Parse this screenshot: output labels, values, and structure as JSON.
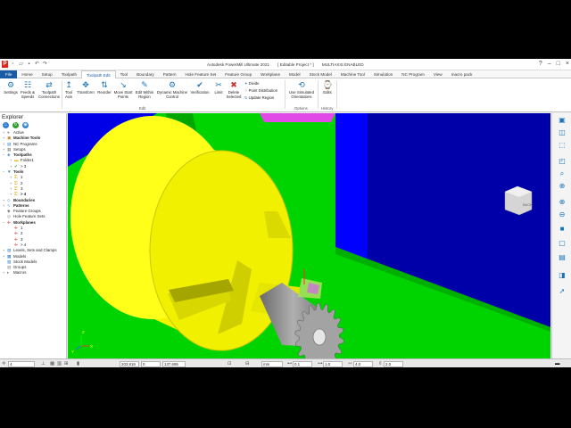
{
  "window": {
    "title": "Autodesk PowerMill Ultimate 2021",
    "project": "[ Editable Project * ]",
    "multiaxis": "MULTIAXIS ENABLED",
    "logo": "P"
  },
  "tabs": [
    "File",
    "Home",
    "Setup",
    "Toolpath",
    "Toolpath Edit",
    "Tool",
    "Boundary",
    "Pattern",
    "Hole Feature Set",
    "Feature Group",
    "Workplane",
    "Model",
    "Stock Model",
    "Machine Tool",
    "Simulation",
    "NC Program",
    "View",
    "macro pack"
  ],
  "ribbon": {
    "buttons": [
      {
        "id": "settings",
        "label": "Settings",
        "icon": "⚙"
      },
      {
        "id": "feeds",
        "label": "Feeds & Speeds",
        "icon": "☷"
      },
      {
        "id": "connections",
        "label": "Toolpath Connections",
        "icon": "⇄"
      },
      {
        "id": "tool-axis",
        "label": "Tool Axis",
        "icon": "↥"
      },
      {
        "id": "transform",
        "label": "Transform",
        "icon": "✥"
      },
      {
        "id": "reorder",
        "label": "Reorder",
        "icon": "⇅"
      },
      {
        "id": "move-start",
        "label": "Move Start Points",
        "icon": "↘"
      },
      {
        "id": "edit-region",
        "label": "Edit Within Region",
        "icon": "✎"
      },
      {
        "id": "dynamic",
        "label": "Dynamic Machine Control",
        "icon": "⚙"
      },
      {
        "id": "verification",
        "label": "Verification",
        "icon": "✔"
      },
      {
        "id": "limit",
        "label": "Limit",
        "icon": "✂"
      },
      {
        "id": "delete-selected",
        "label": "Delete Selected",
        "icon": "✖"
      },
      {
        "id": "simulated",
        "label": "Use Simulated Orientations",
        "icon": "⟲"
      },
      {
        "id": "edits",
        "label": "Edits",
        "icon": "⌚"
      }
    ],
    "small_buttons": [
      {
        "id": "divide",
        "label": "Divide",
        "icon": "✦"
      },
      {
        "id": "point-distribution",
        "label": "Point Distribution",
        "icon": "⁘"
      },
      {
        "id": "update-region",
        "label": "Update Region",
        "icon": "↻"
      }
    ],
    "groups": {
      "edit": "Edit",
      "options": "Options",
      "history": "History"
    }
  },
  "explorer": {
    "title": "Explorer",
    "tree": [
      {
        "label": "Active",
        "level": 0,
        "bold": false,
        "expand": "+",
        "icon": "●",
        "color": "#888888"
      },
      {
        "label": "Machine Tools",
        "level": 0,
        "bold": true,
        "expand": "+",
        "icon": "▣",
        "color": "#d07a20"
      },
      {
        "label": "NC Programs",
        "level": 0,
        "bold": false,
        "expand": "+",
        "icon": "▤",
        "color": "#2f7fd0"
      },
      {
        "label": "Setups",
        "level": 0,
        "bold": false,
        "expand": "+",
        "icon": "▦",
        "color": "#888888"
      },
      {
        "label": "Toolpaths",
        "level": 0,
        "bold": true,
        "expand": "−",
        "icon": "◈",
        "color": "#2f7fd0"
      },
      {
        "label": "Folder1",
        "level": 1,
        "bold": false,
        "expand": "+",
        "icon": "▬",
        "color": "#e6b800"
      },
      {
        "label": "> 3",
        "level": 1,
        "bold": false,
        "expand": "+",
        "icon": "✔",
        "color": "#2e9e2e"
      },
      {
        "label": "Tools",
        "level": 0,
        "bold": true,
        "expand": "−",
        "icon": "▼",
        "color": "#2f7fd0"
      },
      {
        "label": "1",
        "level": 1,
        "bold": false,
        "expand": "+",
        "icon": "⚿",
        "color": "#d4a000"
      },
      {
        "label": "2",
        "level": 1,
        "bold": false,
        "expand": "+",
        "icon": "⚿",
        "color": "#d4a000"
      },
      {
        "label": "3",
        "level": 1,
        "bold": false,
        "expand": "+",
        "icon": "⚿",
        "color": "#d4a000"
      },
      {
        "label": "> 4",
        "level": 1,
        "bold": true,
        "expand": "+",
        "icon": "⚿",
        "color": "#d4a000"
      },
      {
        "label": "Boundaries",
        "level": 0,
        "bold": true,
        "expand": "+",
        "icon": "◇",
        "color": "#2f7fd0"
      },
      {
        "label": "Patterns",
        "level": 0,
        "bold": true,
        "expand": "+",
        "icon": "∿",
        "color": "#2f7fd0"
      },
      {
        "label": "Feature Groups",
        "level": 0,
        "bold": false,
        "expand": "",
        "icon": "◆",
        "color": "#888888"
      },
      {
        "label": "Hole Feature Sets",
        "level": 0,
        "bold": false,
        "expand": "",
        "icon": "◎",
        "color": "#888888"
      },
      {
        "label": "Workplanes",
        "level": 0,
        "bold": true,
        "expand": "−",
        "icon": "✛",
        "color": "#d03030"
      },
      {
        "label": "1",
        "level": 1,
        "bold": false,
        "expand": "",
        "icon": "✛",
        "color": "#d03030"
      },
      {
        "label": "2",
        "level": 1,
        "bold": false,
        "expand": "",
        "icon": "✛",
        "color": "#d03030"
      },
      {
        "label": "3",
        "level": 1,
        "bold": false,
        "expand": "",
        "icon": "✛",
        "color": "#d03030"
      },
      {
        "label": "> 4",
        "level": 1,
        "bold": false,
        "expand": "",
        "icon": "✛",
        "color": "#d03030"
      },
      {
        "label": "Levels, Sets and Clamps",
        "level": 0,
        "bold": false,
        "expand": "+",
        "icon": "▧",
        "color": "#2f7fd0"
      },
      {
        "label": "Models",
        "level": 0,
        "bold": false,
        "expand": "+",
        "icon": "▩",
        "color": "#2f7fd0"
      },
      {
        "label": "Stock Models",
        "level": 0,
        "bold": false,
        "expand": "",
        "icon": "▨",
        "color": "#2f7fd0"
      },
      {
        "label": "Groups",
        "level": 0,
        "bold": false,
        "expand": "",
        "icon": "▤",
        "color": "#888888"
      },
      {
        "label": "Macros",
        "level": 0,
        "bold": false,
        "expand": "+",
        "icon": "▸",
        "color": "#888888"
      }
    ]
  },
  "viewcube": {
    "label": "BACK"
  },
  "axis": {
    "x": "X",
    "y": "Y",
    "z": "Z"
  },
  "status": {
    "workplane": "4",
    "x": "203.819",
    "y": "0",
    "z": "137.695",
    "units": "mm",
    "tol": "0.1",
    "thick": "1.0",
    "stepover": "4.0",
    "stepdown": "2.0"
  },
  "colors": {
    "accent": "#1a5ba5",
    "chuck": "#f3f300",
    "floor": "#00d400",
    "background": "#0000e6",
    "gear": "#8f8f8f",
    "spindle": "#e14ae6"
  }
}
